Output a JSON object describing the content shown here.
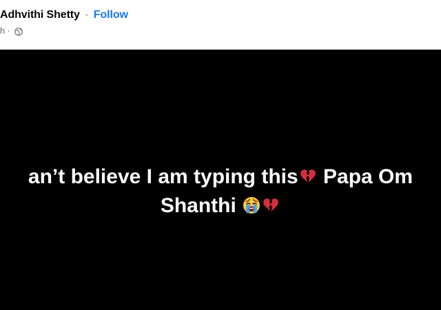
{
  "post": {
    "author_name": "Adhvithi Shetty",
    "separator": "·",
    "follow_label": "Follow",
    "timestamp": "h",
    "meta_separator": "·",
    "privacy_icon": "globe-icon",
    "text_line1": "an’t believe I am typing this",
    "text_line1_after": " Papa Om",
    "text_line2": "Shanthi ",
    "emojis": [
      "broken-heart-icon",
      "crying-face-icon",
      "broken-heart-icon"
    ]
  },
  "colors": {
    "link": "#1877f2",
    "body_background": "#000000",
    "body_text": "#ffffff",
    "secondary_text": "#65676b"
  }
}
